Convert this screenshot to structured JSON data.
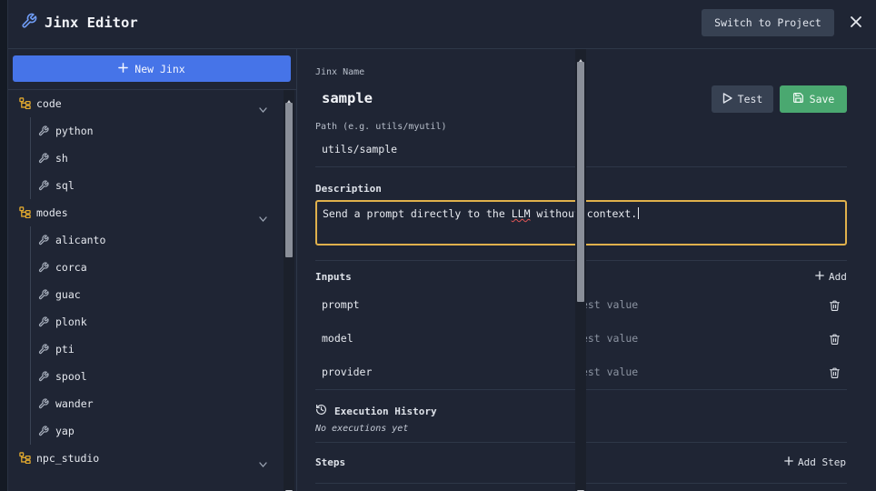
{
  "header": {
    "title": "Jinx Editor",
    "switch_label": "Switch to Project"
  },
  "sidebar": {
    "new_label": "New Jinx",
    "folders": [
      {
        "name": "code",
        "items": [
          "python",
          "sh",
          "sql"
        ]
      },
      {
        "name": "modes",
        "items": [
          "alicanto",
          "corca",
          "guac",
          "plonk",
          "pti",
          "spool",
          "wander",
          "yap"
        ]
      },
      {
        "name": "npc_studio",
        "items": []
      }
    ]
  },
  "editor": {
    "name_label": "Jinx Name",
    "name_value": "sample",
    "test_label": "Test",
    "save_label": "Save",
    "path_label": "Path (e.g. utils/myutil)",
    "path_value": "utils/sample",
    "description_heading": "Description",
    "description_before": "Send a prompt directly to the ",
    "description_misspelled": "LLM",
    "description_after": " without context.",
    "inputs_heading": "Inputs",
    "add_label": "Add",
    "inputs": [
      {
        "name": "prompt",
        "value": "test value"
      },
      {
        "name": "model",
        "value": "test value"
      },
      {
        "name": "provider",
        "value": "test value"
      }
    ],
    "history_heading": "Execution History",
    "no_executions": "No executions yet",
    "steps_heading": "Steps",
    "add_step_label": "Add Step"
  },
  "colors": {
    "accent_blue": "#4674e8",
    "save_green": "#4aa870",
    "focus_border": "#e0b14c",
    "folder_icon": "#e0a82e"
  },
  "icons": {
    "title": "wrench-icon",
    "close": "close-icon",
    "folder": "folder-tree-icon",
    "item": "wrench-icon",
    "test": "play-icon",
    "save": "save-icon",
    "delete": "trash-icon",
    "history": "history-icon"
  }
}
